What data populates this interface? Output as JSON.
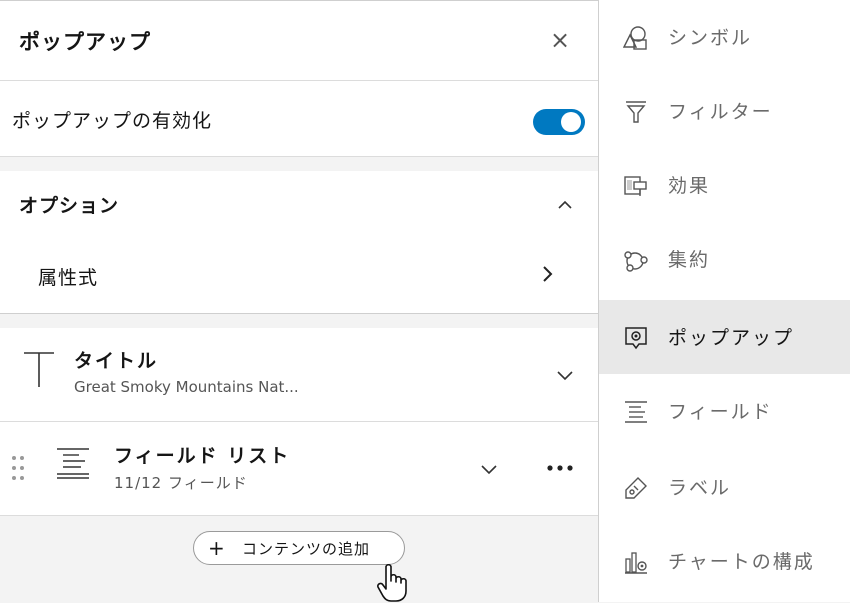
{
  "panel": {
    "title": "ポップアップ",
    "close_label": "×",
    "enable_label": "ポップアップの有効化",
    "enable_on": true,
    "options": {
      "heading": "オプション",
      "attr_label": "属性式"
    },
    "title_card": {
      "name": "タイトル",
      "subtitle": "Great Smoky Mountains Nat..."
    },
    "field_card": {
      "name": "フィールド リスト",
      "subtitle": "11/12 フィールド"
    },
    "add_button": {
      "plus": "+",
      "label": "コンテンツの追加"
    }
  },
  "sidebar": {
    "items": [
      {
        "label": "シンボル",
        "icon": "symbol-icon",
        "active": false
      },
      {
        "label": "フィルター",
        "icon": "filter-icon",
        "active": false
      },
      {
        "label": "効果",
        "icon": "effects-icon",
        "active": false
      },
      {
        "label": "集約",
        "icon": "aggregation-icon",
        "active": false
      },
      {
        "label": "ポップアップ",
        "icon": "popup-icon",
        "active": true
      },
      {
        "label": "フィールド",
        "icon": "fields-icon",
        "active": false
      },
      {
        "label": "ラベル",
        "icon": "label-icon",
        "active": false
      },
      {
        "label": "チャートの構成",
        "icon": "chart-config-icon",
        "active": false
      }
    ]
  },
  "colors": {
    "accent": "#0079c1",
    "active_bg": "#e8e8e8",
    "panel_bg": "#f3f3f3"
  }
}
